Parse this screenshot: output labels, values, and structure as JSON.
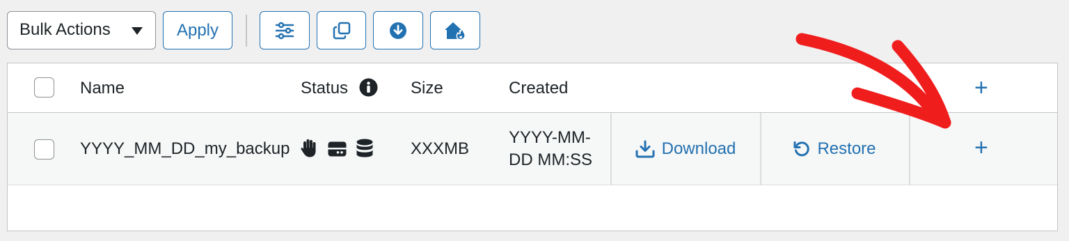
{
  "toolbar": {
    "bulk_actions_label": "Bulk Actions",
    "apply_label": "Apply",
    "icon_buttons": [
      "filter-sliders-icon",
      "copy-icon",
      "download-circle-icon",
      "home-fire-icon"
    ]
  },
  "table": {
    "headers": {
      "name": "Name",
      "status": "Status",
      "size": "Size",
      "created": "Created",
      "add": "+"
    },
    "rows": [
      {
        "name": "YYYY_MM_DD_my_backup",
        "status_icons": [
          "hand-icon",
          "server-icon",
          "database-icon"
        ],
        "size": "XXXMB",
        "created_line1": "YYYY-MM-",
        "created_line2": "DD MM:SS",
        "download_label": "Download",
        "restore_label": "Restore",
        "add": "+"
      }
    ]
  },
  "colors": {
    "accent": "#2271b1",
    "annotation_arrow": "#f01d1d"
  }
}
